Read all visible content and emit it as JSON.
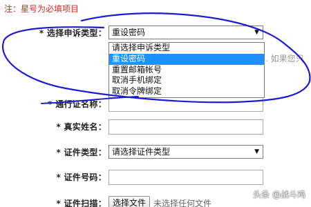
{
  "note": "注：星号为必填项目",
  "colors": {
    "note": "#e0261e",
    "selected_bg": "#1e90ff",
    "annotation_stroke": "#1a1ad6"
  },
  "form": {
    "appeal_type": {
      "label": "* 选择申诉类型：",
      "value": "重设密码",
      "options": [
        "请选择申诉类型",
        "重设密码",
        "重置邮箱帐号",
        "取消手机绑定",
        "取消令牌绑定"
      ],
      "selected_index": 1
    },
    "hint": ". 如果您只",
    "pass_name": {
      "label": "* 通行证名称：",
      "value": ""
    },
    "real_name": {
      "label": "* 真实姓名：",
      "value": ""
    },
    "id_type": {
      "label": "* 证件类型：",
      "value": "请选择证件类型"
    },
    "id_number": {
      "label": "* 证件号码：",
      "value": ""
    },
    "id_scan": {
      "label": "* 证件扫描：",
      "button_label": "选择文件",
      "status": "未选择任何文件"
    }
  },
  "watermark": "头条 @战斗鸡",
  "icons": {
    "select_arrow": "dropdown-arrow-icon"
  }
}
